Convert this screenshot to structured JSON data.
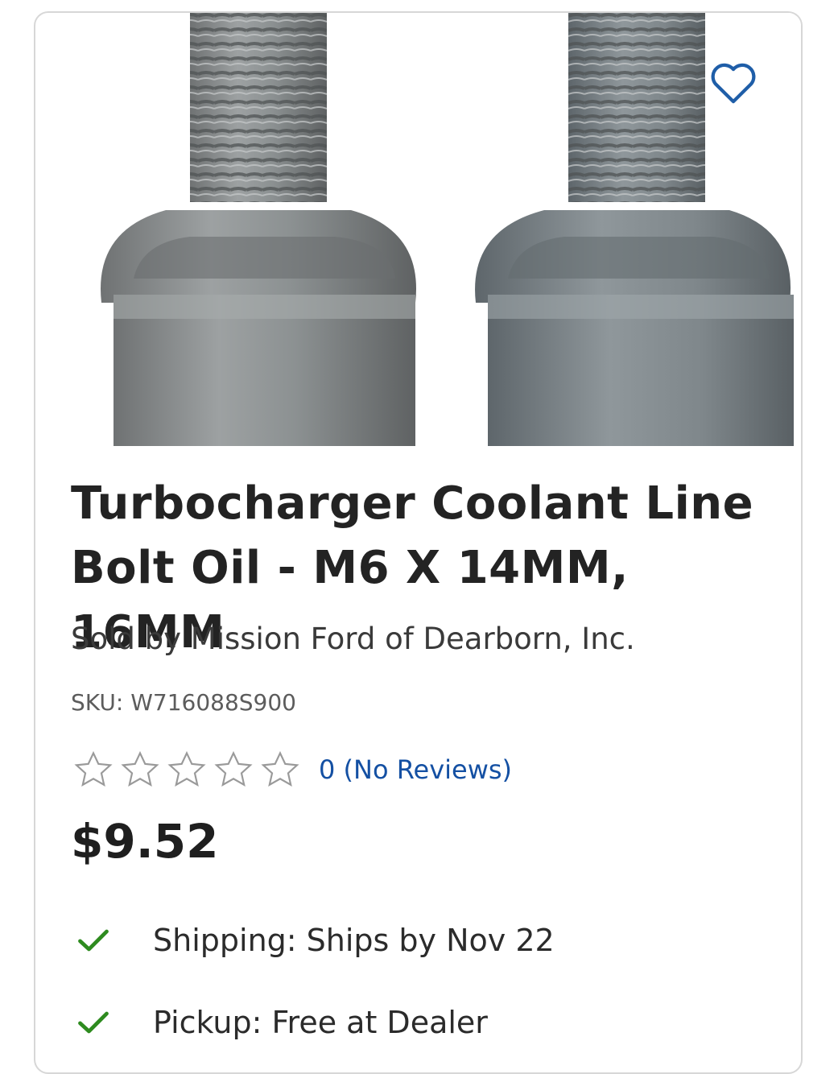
{
  "product": {
    "image_alt_icon": "bolt-photo",
    "favorite_icon": "heart-outline-icon",
    "title": "Turbocharger Coolant Line Bolt Oil - M6 X 14MM, 16MM",
    "seller": "Sold by Mission Ford of Dearborn, Inc.",
    "sku": "SKU: W716088S900",
    "rating": {
      "stars_filled": 0,
      "stars_total": 5,
      "reviews_text": "0 (No Reviews)"
    },
    "price": "$9.52"
  },
  "fulfillment": {
    "shipping": "Shipping: Ships by Nov 22",
    "pickup": "Pickup: Free at Dealer"
  },
  "colors": {
    "link": "#1450a3",
    "check": "#2e8b1f",
    "favorite": "#1f5ea8",
    "star_outline": "#9a9a9a"
  }
}
